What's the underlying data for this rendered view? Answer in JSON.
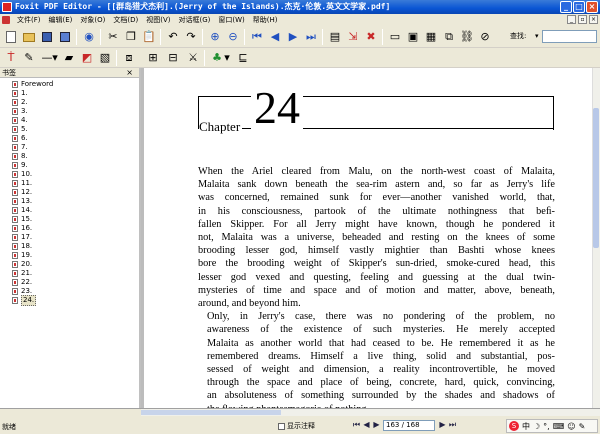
{
  "window": {
    "title": "Foxit PDF Editor - [[群岛猎犬杰利].(Jerry of the Islands).杰克·伦敦.英文文学家.pdf]",
    "minimize": "_",
    "maximize": "□",
    "close": "×"
  },
  "menu": {
    "items": [
      "文件(F)",
      "编辑(E)",
      "对象(O)",
      "文档(D)",
      "视图(V)",
      "对话框(G)",
      "窗口(W)",
      "帮助(H)"
    ]
  },
  "toolbar": {
    "search_label": "查找:",
    "search_value": ""
  },
  "bookmarks": {
    "header": "书签",
    "close": "×",
    "items": [
      "Foreword",
      "1.",
      "2.",
      "3.",
      "4.",
      "5.",
      "6.",
      "7.",
      "8.",
      "9.",
      "10.",
      "11.",
      "12.",
      "13.",
      "14.",
      "15.",
      "16.",
      "17.",
      "18.",
      "19.",
      "20.",
      "21.",
      "22.",
      "23.",
      "24."
    ],
    "selected": "24."
  },
  "document": {
    "chapter_word": "Chapter",
    "chapter_number": "24",
    "para1_lines": [
      "When the Ariel cleared from Malu, on the north-west coast of Malaita,",
      "Malaita sank down beneath the sea-rim astern and, so far as Jerry's life",
      "was concerned, remained sunk for ever—another vanished world, that,",
      "in his consciousness, partook of the ultimate nothingness that beﬁ-",
      "fallen Skipper. For all Jerry might have known, though he pondered it",
      "not, Malaita was a universe, beheaded and resting on the knees of some",
      "brooding lesser god, himself vastly mightier than Bashti whose knees",
      "bore the brooding weight of Skipper's sun-dried, smoke-cured head, this",
      "lesser god vexed and questing, feeling and guessing at the dual twin-",
      "mysteries of time and space and of motion and matter, above, beneath,",
      "around, and beyond him."
    ],
    "para2_lines": [
      "Only, in Jerry's case, there was no pondering of the problem, no",
      "awareness of the existence of such mysteries. He merely accepted",
      "Malaita as another world that had ceased to be. He remembered it as he",
      "remembered dreams. Himself a live thing, solid and substantial, pos-",
      "sessed of weight and dimension, a reality incontrovertible, he moved",
      "through the space and place of being, concrete, hard, quick, convincing,",
      "an absoluteness of something surrounded by the shades and shadows of",
      "the ﬂowing phantasmagoria of nothing."
    ]
  },
  "status": {
    "left": "就绪",
    "show_notes": "显示注释",
    "page_counter": "163 / 168",
    "ime_label": "中"
  }
}
